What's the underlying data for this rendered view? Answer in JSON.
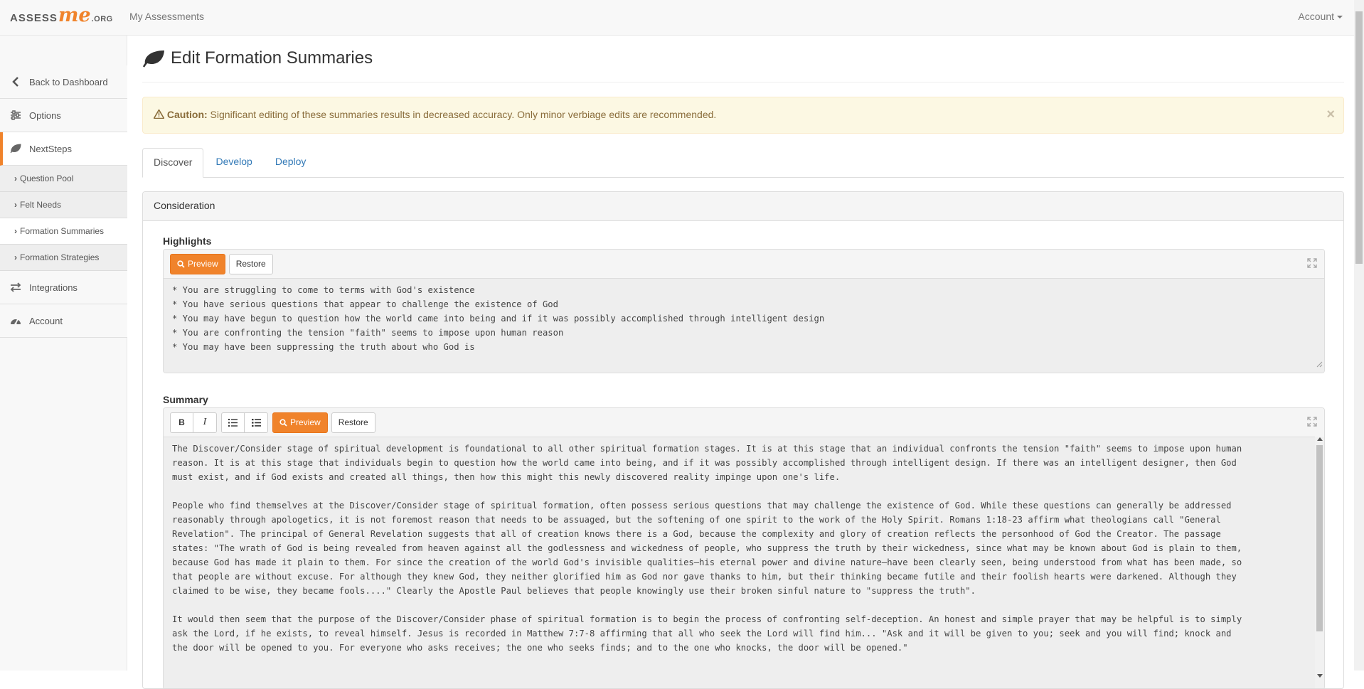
{
  "navbar": {
    "brand_part1": "ASSESS",
    "brand_part2": "me",
    "brand_part3": ".ORG",
    "my_assessments": "My Assessments",
    "account": "Account"
  },
  "sidebar": {
    "items": [
      {
        "label": "Back to Dashboard",
        "icon": "chevron-left-icon"
      },
      {
        "label": "Options",
        "icon": "sliders-icon"
      },
      {
        "label": "NextSteps",
        "icon": "leaf-icon"
      },
      {
        "label": "Integrations",
        "icon": "exchange-icon"
      },
      {
        "label": "Account",
        "icon": "dashboard-gauge-icon"
      }
    ],
    "subitems": [
      {
        "label": "Question Pool"
      },
      {
        "label": "Felt Needs"
      },
      {
        "label": "Formation Summaries"
      },
      {
        "label": "Formation Strategies"
      }
    ]
  },
  "page": {
    "title": "Edit Formation Summaries"
  },
  "alert": {
    "strong": "Caution:",
    "text": " Significant editing of these summaries results in decreased accuracy. Only minor verbiage edits are recommended.",
    "close": "×"
  },
  "tabs": [
    "Discover",
    "Develop",
    "Deploy"
  ],
  "panel": {
    "heading": "Consideration",
    "highlights": {
      "label": "Highlights",
      "preview": "Preview",
      "restore": "Restore",
      "text": "* You are struggling to come to terms with God's existence\n* You have serious questions that appear to challenge the existence of God\n* You may have begun to question how the world came into being and if it was possibly accomplished through intelligent design\n* You are confronting the tension \"faith\" seems to impose upon human reason\n* You may have been suppressing the truth about who God is"
    },
    "summary": {
      "label": "Summary",
      "bold": "B",
      "italic": "I",
      "preview": "Preview",
      "restore": "Restore",
      "text": "The Discover/Consider stage of spiritual development is foundational to all other spiritual formation stages. It is at this stage that an individual confronts the tension \"faith\" seems to impose upon human\nreason. It is at this stage that individuals begin to question how the world came into being, and if it was possibly accomplished through intelligent design. If there was an intelligent designer, then God\nmust exist, and if God exists and created all things, then how this might this newly discovered reality impinge upon one's life.\n\nPeople who find themselves at the Discover/Consider stage of spiritual formation, often possess serious questions that may challenge the existence of God. While these questions can generally be addressed\nreasonably through apologetics, it is not foremost reason that needs to be assuaged, but the softening of one spirit to the work of the Holy Spirit. Romans 1:18-23 affirm what theologians call \"General\nRevelation\". The principal of General Revelation suggests that all of creation knows there is a God, because the complexity and glory of creation reflects the personhood of God the Creator. The passage\nstates: \"The wrath of God is being revealed from heaven against all the godlessness and wickedness of people, who suppress the truth by their wickedness, since what may be known about God is plain to them,\nbecause God has made it plain to them. For since the creation of the world God's invisible qualities—his eternal power and divine nature—have been clearly seen, being understood from what has been made, so\nthat people are without excuse. For although they knew God, they neither glorified him as God nor gave thanks to him, but their thinking became futile and their foolish hearts were darkened. Although they\nclaimed to be wise, they became fools....\" Clearly the Apostle Paul believes that people knowingly use their broken sinful nature to \"suppress the truth\".\n\nIt would then seem that the purpose of the Discover/Consider phase of spiritual formation is to begin the process of confronting self-deception. An honest and simple prayer that may be helpful is to simply\nask the Lord, if he exists, to reveal himself. Jesus is recorded in Matthew 7:7-8 affirming that all who seek the Lord will find him... \"Ask and it will be given to you; seek and you will find; knock and\nthe door will be opened to you. For everyone who asks receives; the one who seeks finds; and to the one who knocks, the door will be opened.\""
    }
  },
  "colors": {
    "accent": "#f0832b",
    "link": "#337ab7",
    "alert_bg": "#fcf8e3",
    "alert_text": "#8a6d3b"
  }
}
